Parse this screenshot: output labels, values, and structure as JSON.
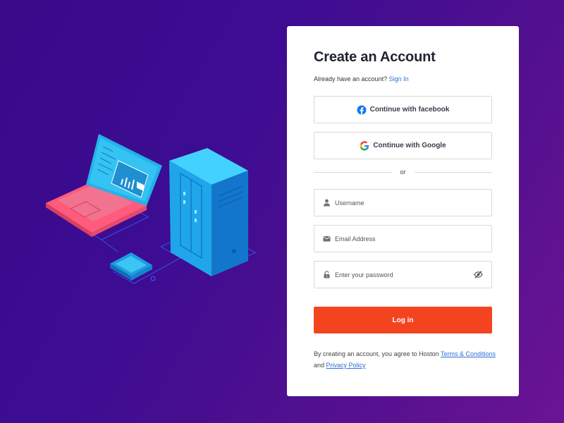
{
  "page": {
    "title": "Create an Account",
    "have_account_text": "Already have an account?",
    "sign_in_link": "Sign In"
  },
  "social": {
    "facebook_label": "Continue with facebook",
    "google_label": "Continue with Google"
  },
  "divider_text": "or",
  "form": {
    "username_placeholder": "Username",
    "username_value": "",
    "email_placeholder": "Email Address",
    "email_value": "",
    "password_placeholder": "Enter your password",
    "password_value": ""
  },
  "login_button": "Log in",
  "terms": {
    "prefix": "By creating an account, you agree to Hoston",
    "terms_link": "Terms & Conditions",
    "and_text": "and",
    "privacy_link": "Privacy Policy"
  },
  "icons": {
    "facebook": "facebook-icon",
    "google": "google-icon",
    "user": "user-icon",
    "email": "envelope-icon",
    "password": "lock-icon",
    "toggle_visibility": "eye-slash-icon"
  },
  "colors": {
    "accent": "#f4441f",
    "link": "#2f6fd6",
    "facebook": "#1877f2",
    "background_start": "#3a0a8a",
    "background_end": "#6a1494"
  }
}
